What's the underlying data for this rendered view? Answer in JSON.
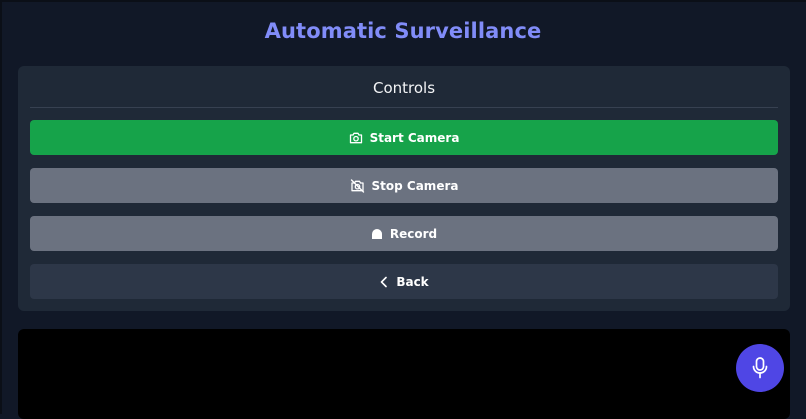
{
  "header": {
    "title": "Automatic Surveillance"
  },
  "controls": {
    "title": "Controls",
    "buttons": {
      "start_camera": {
        "label": "Start Camera",
        "icon": "camera-icon",
        "color": "#16a34a"
      },
      "stop_camera": {
        "label": "Stop Camera",
        "icon": "camera-off-icon",
        "color": "#6b7280"
      },
      "record": {
        "label": "Record",
        "icon": "record-icon",
        "color": "#6b7280"
      },
      "back": {
        "label": "Back",
        "icon": "chevron-left-icon",
        "color": "#2d3748"
      }
    }
  },
  "voice": {
    "icon": "microphone-icon",
    "color": "#4f46e5"
  },
  "theme": {
    "background": "#111827",
    "panel": "#1f2937",
    "accent": "#818cf8"
  }
}
